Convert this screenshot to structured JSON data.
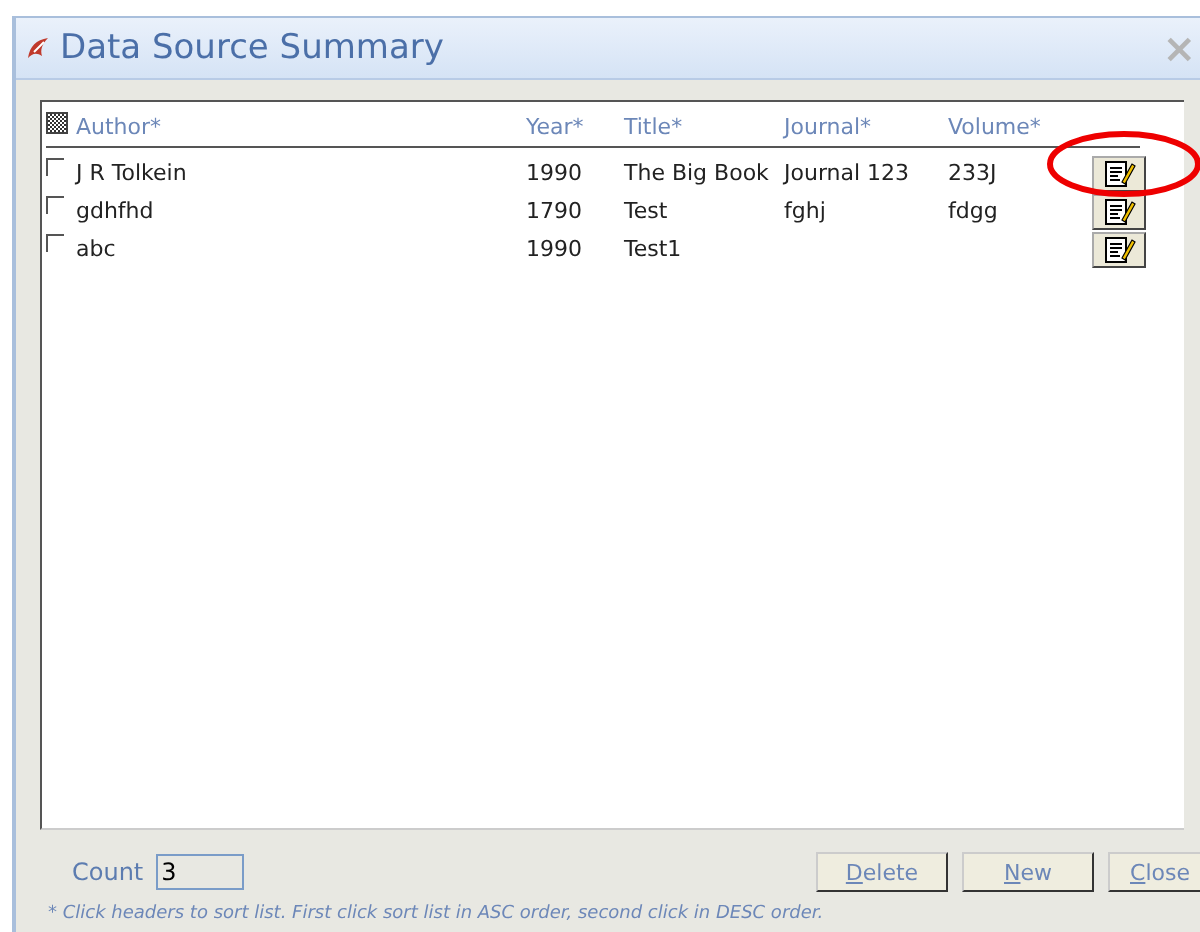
{
  "window": {
    "title": "Data Source Summary",
    "close": "×"
  },
  "table": {
    "select_all": {
      "indeterminate": true
    },
    "columns": [
      "Author*",
      "Year*",
      "Title*",
      "Journal*",
      "Volume*"
    ],
    "rows": [
      {
        "checked": false,
        "cells": [
          "J R Tolkein",
          "1990",
          "The Big Book",
          "Journal 123",
          "233J"
        ]
      },
      {
        "checked": false,
        "cells": [
          "gdhfhd",
          "1790",
          "Test",
          "fghj",
          "fdgg"
        ]
      },
      {
        "checked": false,
        "cells": [
          "abc",
          "1990",
          "Test1",
          "",
          ""
        ]
      }
    ]
  },
  "count": {
    "label": "Count",
    "value": "3"
  },
  "buttons": [
    "Delete",
    "New",
    "Close"
  ],
  "hint": "* Click headers to sort list. First click sort list in ASC order, second click in DESC order."
}
